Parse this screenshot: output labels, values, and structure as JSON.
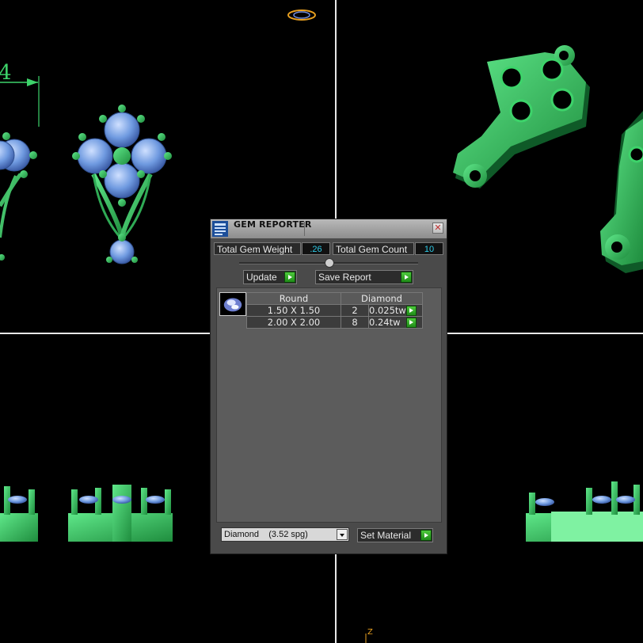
{
  "panel": {
    "title": "GEM REPORTER",
    "close_icon": "close-icon",
    "total_weight_label": "Total Gem Weight",
    "total_weight_value": ".26",
    "total_count_label": "Total Gem Count",
    "total_count_value": "10",
    "update_label": "Update",
    "save_report_label": "Save Report",
    "table": {
      "headers": [
        "Round",
        "Diamond"
      ],
      "rows": [
        {
          "size": "1.50 X 1.50",
          "count": "2",
          "weight": "0.025tw"
        },
        {
          "size": "2.00 X 2.00",
          "count": "8",
          "weight": "0.24tw"
        }
      ]
    },
    "material_select": {
      "name": "Diamond",
      "density": "(3.52 spg)"
    },
    "set_material_label": "Set Material"
  },
  "viewport": {
    "dimension_text": "4",
    "axis_label": "Z"
  },
  "colors": {
    "panel_bg": "#4a4a4a",
    "value_text": "#2ecbe8",
    "metal_green": "#3dd36a",
    "gem_blue": "#7fa6e8",
    "button_green": "#2ea82a"
  }
}
